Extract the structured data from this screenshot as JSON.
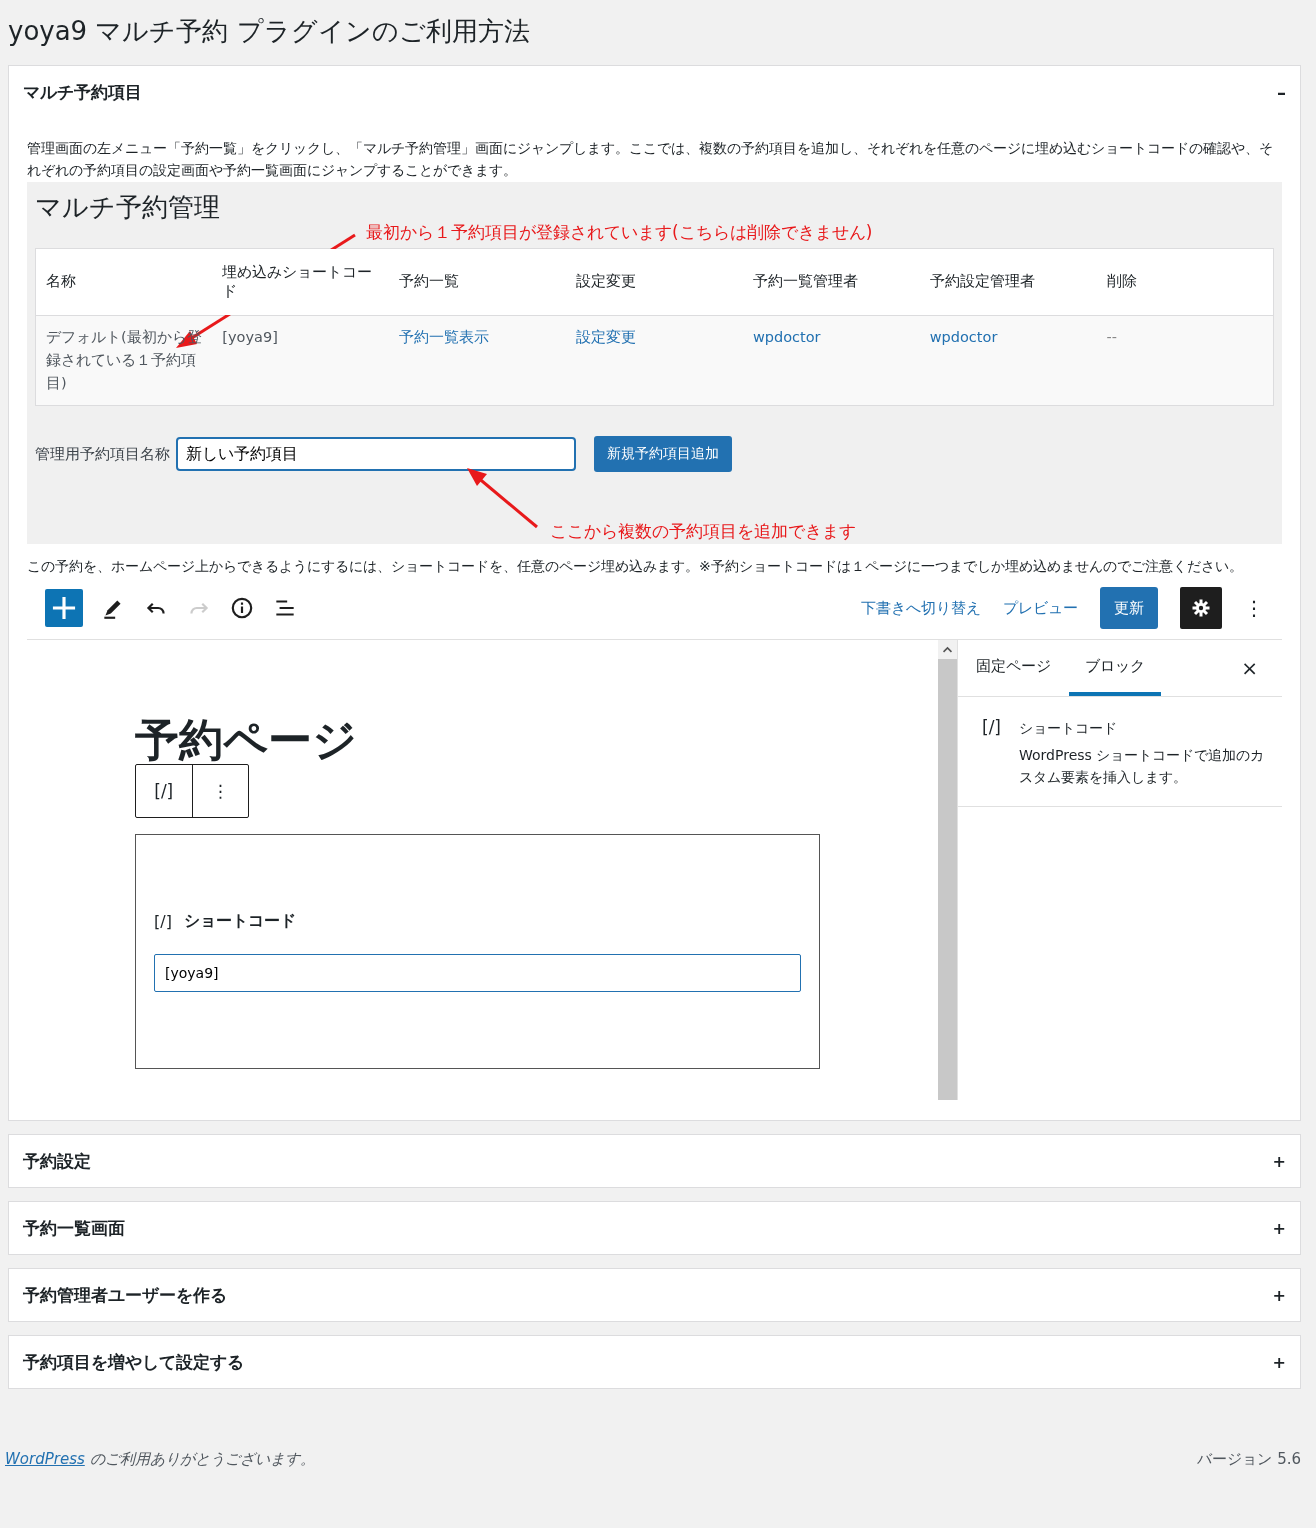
{
  "page_title": "yoya9 マルチ予約 プラグインのご利用方法",
  "sections": [
    {
      "title": "マルチ予約項目",
      "expanded": true,
      "toggle": "–",
      "intro": "管理画面の左メニュー「予約一覧」をクリックし、「マルチ予約管理」画面にジャンプします。ここでは、複数の予約項目を追加し、それぞれを任意のページに埋め込むショートコードの確認や、それぞれの予約項目の設定画面や予約一覧画面にジャンプすることができます。",
      "admin_screenshot": {
        "heading": "マルチ予約管理",
        "annotation_top": "最初から１予約項目が登録されています(こちらは削除できません)",
        "table": {
          "columns": [
            "名称",
            "埋め込みショートコード",
            "予約一覧",
            "設定変更",
            "予約一覧管理者",
            "予約設定管理者",
            "削除"
          ],
          "rows": [
            [
              {
                "text": "デフォルト(最初から登録されている１予約項目)",
                "kind": "text"
              },
              {
                "text": "[yoya9]",
                "kind": "text"
              },
              {
                "text": "予約一覧表示",
                "kind": "link"
              },
              {
                "text": "設定変更",
                "kind": "link"
              },
              {
                "text": "wpdoctor",
                "kind": "link"
              },
              {
                "text": "wpdoctor",
                "kind": "link"
              },
              {
                "text": "--",
                "kind": "muted"
              }
            ]
          ]
        },
        "name_label": "管理用予約項目名称",
        "name_value": "新しい予約項目",
        "add_button": "新規予約項目追加",
        "annotation_bottom": "ここから複数の予約項目を追加できます"
      },
      "note": "この予約を、ホームページ上からできるようにするには、ショートコードを、任意のページ埋め込みます。※予約ショートコードは１ページに一つまでしか埋め込めませんのでご注意ください。",
      "editor_screenshot": {
        "tools": [
          {
            "kind": "add",
            "disabled": false
          },
          {
            "kind": "edit",
            "disabled": false
          },
          {
            "kind": "undo",
            "disabled": false
          },
          {
            "kind": "redo",
            "disabled": true
          },
          {
            "kind": "info",
            "disabled": false
          },
          {
            "kind": "outline",
            "disabled": false
          }
        ],
        "draft_link": "下書きへ切り替え",
        "preview_link": "プレビュー",
        "update_button": "更新",
        "more": "⋮",
        "post_title": "予約ページ",
        "block_toolbar": {
          "icon": "[/]",
          "more": "⋮"
        },
        "shortcode_block": {
          "icon": "[/]",
          "label": "ショートコード",
          "value": "[yoya9]"
        },
        "sidebar": {
          "tabs": [
            {
              "label": "固定ページ",
              "selected": false
            },
            {
              "label": "ブロック",
              "selected": true
            }
          ],
          "close": "×",
          "block_icon": "[/]",
          "block_name": "ショートコード",
          "block_description": "WordPress ショートコードで追加のカスタム要素を挿入します。"
        }
      }
    },
    {
      "title": "予約設定",
      "expanded": false,
      "toggle": "+"
    },
    {
      "title": "予約一覧画面",
      "expanded": false,
      "toggle": "+"
    },
    {
      "title": "予約管理者ユーザーを作る",
      "expanded": false,
      "toggle": "+"
    },
    {
      "title": "予約項目を増やして設定する",
      "expanded": false,
      "toggle": "+"
    }
  ],
  "footer": {
    "link": "WordPress",
    "thanks": "のご利用ありがとうございます。",
    "version": "バージョン 5.6"
  }
}
